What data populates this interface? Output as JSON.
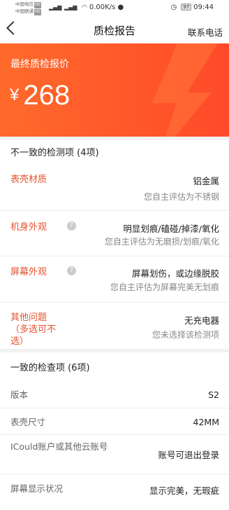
{
  "status_bar": {
    "carrier1": "中国电信",
    "carrier2": "中国联通",
    "hd_badge": "HD",
    "speed": "0.00K/s",
    "battery": "97",
    "time": "09:44"
  },
  "nav": {
    "title": "质检报告",
    "contact": "联系电话"
  },
  "banner": {
    "label": "最终质检报价",
    "currency": "¥",
    "price": "268"
  },
  "inconsistent": {
    "title": "不一致的检测项 (4项)",
    "items": [
      {
        "label": "表壳材质",
        "value": "铝金属",
        "sub": "您自主评估为不锈钢"
      },
      {
        "label": "机身外观",
        "value": "明显划痕/磕碰/掉漆/氧化",
        "sub": "您自主评估为无磨损/划痕/氧化"
      },
      {
        "label": "屏幕外观",
        "value": "屏幕划伤，或边缘脱胶",
        "sub": "您自主评估为屏幕完美无划痕"
      },
      {
        "label": "其他问题",
        "label_note": "（多选可不选）",
        "value": "无充电器",
        "sub": "您未选择该检测项"
      }
    ]
  },
  "consistent": {
    "title": "一致的检查项 (6项)",
    "items": [
      {
        "label": "版本",
        "value": "S2"
      },
      {
        "label": "表壳尺寸",
        "value": "42MM"
      },
      {
        "label": "ICould账户或其他云账号",
        "value": "账号可退出登录"
      },
      {
        "label": "屏幕显示状况",
        "value": "显示完美，无瑕疵"
      }
    ]
  },
  "colors": {
    "accent": "#e5532c",
    "banner_start": "#ff6a2b",
    "banner_end": "#ff4a2a"
  }
}
